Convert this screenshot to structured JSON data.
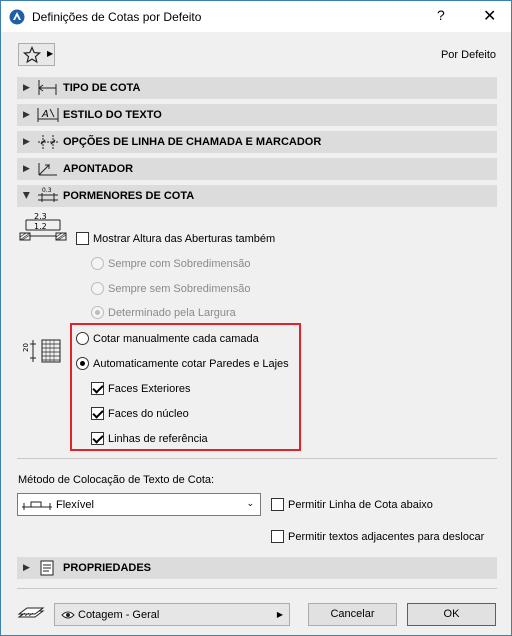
{
  "window": {
    "title": "Definições de Cotas por Defeito",
    "help_label": "?",
    "close_label": "✕"
  },
  "favorites": {
    "label": "Por Defeito"
  },
  "sections": {
    "tipo_cota": "TIPO DE COTA",
    "estilo_texto": "ESTILO DO TEXTO",
    "opcoes_linha": "OPÇÕES DE LINHA DE CHAMADA E MARCADOR",
    "apontador": "APONTADOR",
    "pormenores": "PORMENORES DE COTA",
    "propriedades": "PROPRIEDADES"
  },
  "details": {
    "icon_top_value": "2.3",
    "icon_bottom_value": "1.2",
    "mostrar_altura": "Mostrar Altura das Aberturas também",
    "sempre_com": "Sempre com Sobredimensão",
    "sempre_sem": "Sempre sem Sobredimensão",
    "determinado": "Determinado pela Largura",
    "layer_icon_value": "20",
    "cotar_manual": "Cotar manualmente cada camada",
    "auto_cotar": "Automaticamente cotar Paredes e Lajes",
    "faces_exteriores": "Faces Exteriores",
    "faces_nucleo": "Faces do núcleo",
    "linhas_referencia": "Linhas de referência"
  },
  "placement": {
    "label": "Método de Colocação de Texto de Cota:",
    "selected": "Flexível",
    "permitir_linha": "Permitir Linha de Cota abaixo",
    "permitir_textos": "Permitir textos adjacentes para deslocar"
  },
  "footer": {
    "layer": "Cotagem - Geral",
    "cancel": "Cancelar",
    "ok": "OK"
  },
  "colors": {
    "accent": "#0078d7",
    "highlight": "#e0242c"
  }
}
